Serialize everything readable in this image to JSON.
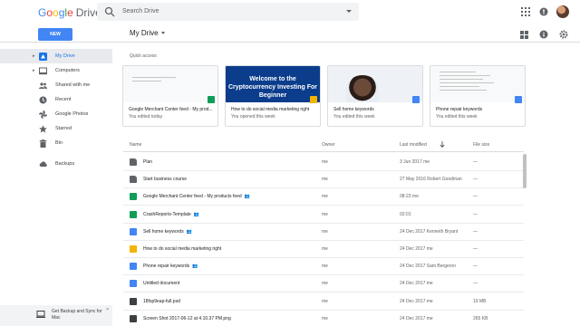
{
  "app": {
    "logo_google": [
      "G",
      "o",
      "o",
      "g",
      "l",
      "e"
    ],
    "logo_drive": "Drive",
    "search_placeholder": "Search Drive"
  },
  "toolbar": {
    "new_label": "NEW",
    "breadcrumb": "My Drive"
  },
  "sidebar": {
    "items": [
      {
        "label": "My Drive",
        "icon": "drive-icon",
        "active": true
      },
      {
        "label": "Computers",
        "icon": "computer-icon",
        "active": false
      },
      {
        "label": "Shared with me",
        "icon": "people-icon",
        "active": false
      },
      {
        "label": "Recent",
        "icon": "clock-icon",
        "active": false
      },
      {
        "label": "Google Photos",
        "icon": "pinwheel-icon",
        "active": false
      },
      {
        "label": "Starred",
        "icon": "star-icon",
        "active": false
      },
      {
        "label": "Bin",
        "icon": "trash-icon",
        "active": false
      },
      {
        "label": "Backups",
        "icon": "cloud-icon",
        "active": false
      }
    ],
    "backup_promo": "Get Backup and Sync for Mac",
    "backup_close": "×"
  },
  "quick_access": {
    "label": "Quick access",
    "cards": [
      {
        "title": "Google Merchant Center feed - My prod...",
        "subtitle": "You edited today",
        "badge_color": "#0f9d58",
        "thumb": "sheet"
      },
      {
        "title": "How to do social media marketing right",
        "subtitle": "You opened this week",
        "badge_color": "#f4b400",
        "thumb": "promo",
        "thumb_text": "Welcome to the Cryptocurrency Investing For Beginner"
      },
      {
        "title": "Sell home keywords",
        "subtitle": "You edited this week",
        "badge_color": "#4285f4",
        "thumb": "face"
      },
      {
        "title": "Phone repair keywords",
        "subtitle": "You edited this week",
        "badge_color": "#4285f4",
        "thumb": "doc"
      }
    ]
  },
  "list": {
    "headers": {
      "name": "Name",
      "owner": "Owner",
      "modified": "Last modified",
      "size": "File size"
    },
    "rows": [
      {
        "name": "Plan",
        "type": "folder",
        "shared": false,
        "owner": "me",
        "modified": "3 Jun 2017 me",
        "size": "—"
      },
      {
        "name": "Start business course",
        "type": "shared-folder",
        "shared": false,
        "owner": "me",
        "modified": "27 May 2016 Robert Goodman",
        "size": "—"
      },
      {
        "name": "Google Merchant Center feed - My products feed",
        "type": "sheet",
        "shared": true,
        "owner": "me",
        "modified": "08:23 me",
        "size": "—"
      },
      {
        "name": "CrashReports-Template",
        "type": "sheet",
        "shared": true,
        "owner": "me",
        "modified": "02:01",
        "size": "—"
      },
      {
        "name": "Sell home keywords",
        "type": "doc",
        "shared": true,
        "owner": "me",
        "modified": "24 Dec 2017 Kenneth Bryant",
        "size": "—"
      },
      {
        "name": "How to do social media marketing right",
        "type": "slides",
        "shared": false,
        "owner": "me",
        "modified": "24 Dec 2017 me",
        "size": "—"
      },
      {
        "name": "Phone repair keywords",
        "type": "doc",
        "shared": true,
        "owner": "me",
        "modified": "24 Dec 2017 Sam Bergeron",
        "size": "—"
      },
      {
        "name": "Untitled document",
        "type": "doc",
        "shared": false,
        "owner": "me",
        "modified": "24 Dec 2017 me",
        "size": "—"
      },
      {
        "name": "18fsp9eap-full.psd",
        "type": "image",
        "shared": false,
        "owner": "me",
        "modified": "24 Dec 2017 me",
        "size": "19 MB"
      },
      {
        "name": "Screen Shot 2017-06-12 at 4.10.37 PM.png",
        "type": "image",
        "shared": false,
        "owner": "me",
        "modified": "24 Dec 2017 me",
        "size": "265 KB"
      }
    ]
  },
  "colors": {
    "accent": "#4285f4",
    "sheet": "#0f9d58",
    "doc": "#4285f4",
    "slides": "#f4b400",
    "folder": "#5f6368"
  }
}
